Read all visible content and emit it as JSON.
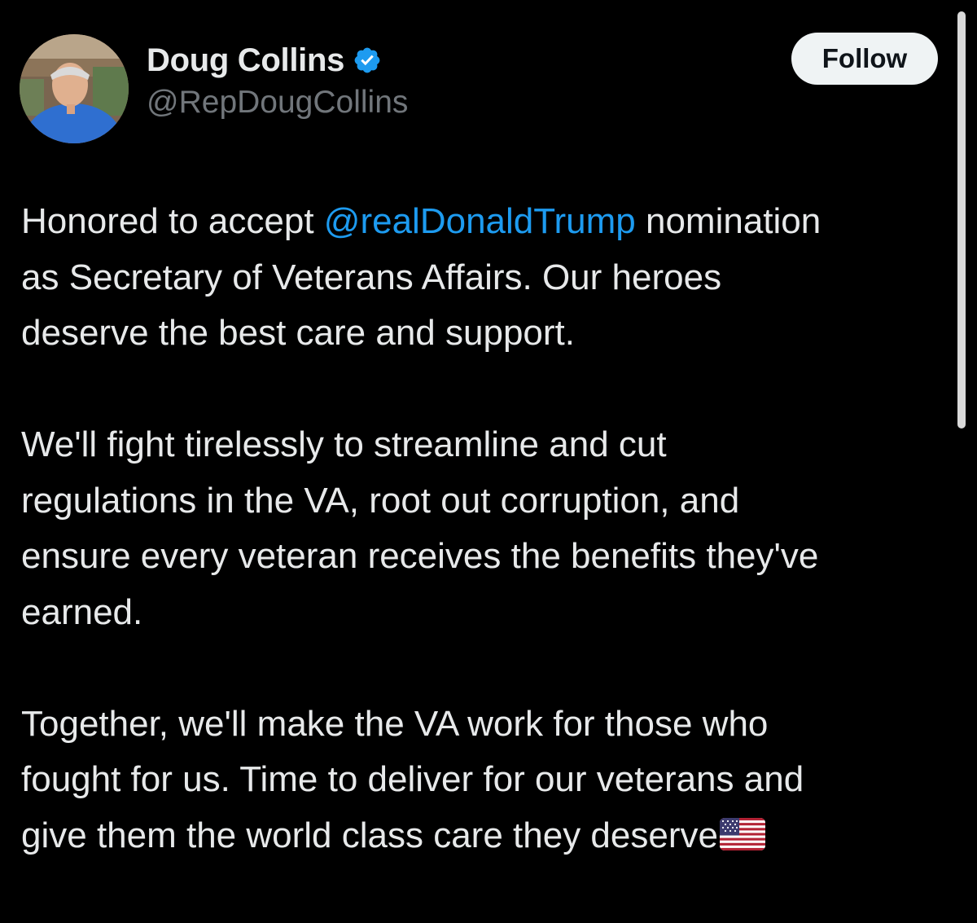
{
  "author": {
    "display_name": "Doug Collins",
    "handle": "@RepDougCollins",
    "verified": true,
    "avatar": "profile-photo"
  },
  "actions": {
    "follow_label": "Follow"
  },
  "post": {
    "paragraphs": [
      {
        "lines": [
          {
            "before": "Honored to accept ",
            "mention": "@realDonaldTrump",
            "after": " nomination"
          },
          {
            "text": "as Secretary of Veterans Affairs. Our heroes"
          },
          {
            "text": "deserve the best care and support."
          }
        ]
      },
      {
        "lines": [
          {
            "text": "We'll fight tirelessly to streamline and cut"
          },
          {
            "text": "regulations in the VA, root out corruption, and"
          },
          {
            "text": "ensure every veteran receives the benefits they've"
          },
          {
            "text": "earned."
          }
        ]
      },
      {
        "lines": [
          {
            "text": "Together, we'll make the VA work for those who"
          },
          {
            "text": "fought for us. Time to deliver for our veterans and"
          },
          {
            "text": "give them the world class care they deserve",
            "emoji": "us-flag-emoji"
          }
        ]
      }
    ]
  },
  "colors": {
    "background": "#000000",
    "text": "#e7e9ea",
    "secondary_text": "#71767b",
    "accent": "#1d9bf0",
    "button_bg": "#eff3f4"
  }
}
